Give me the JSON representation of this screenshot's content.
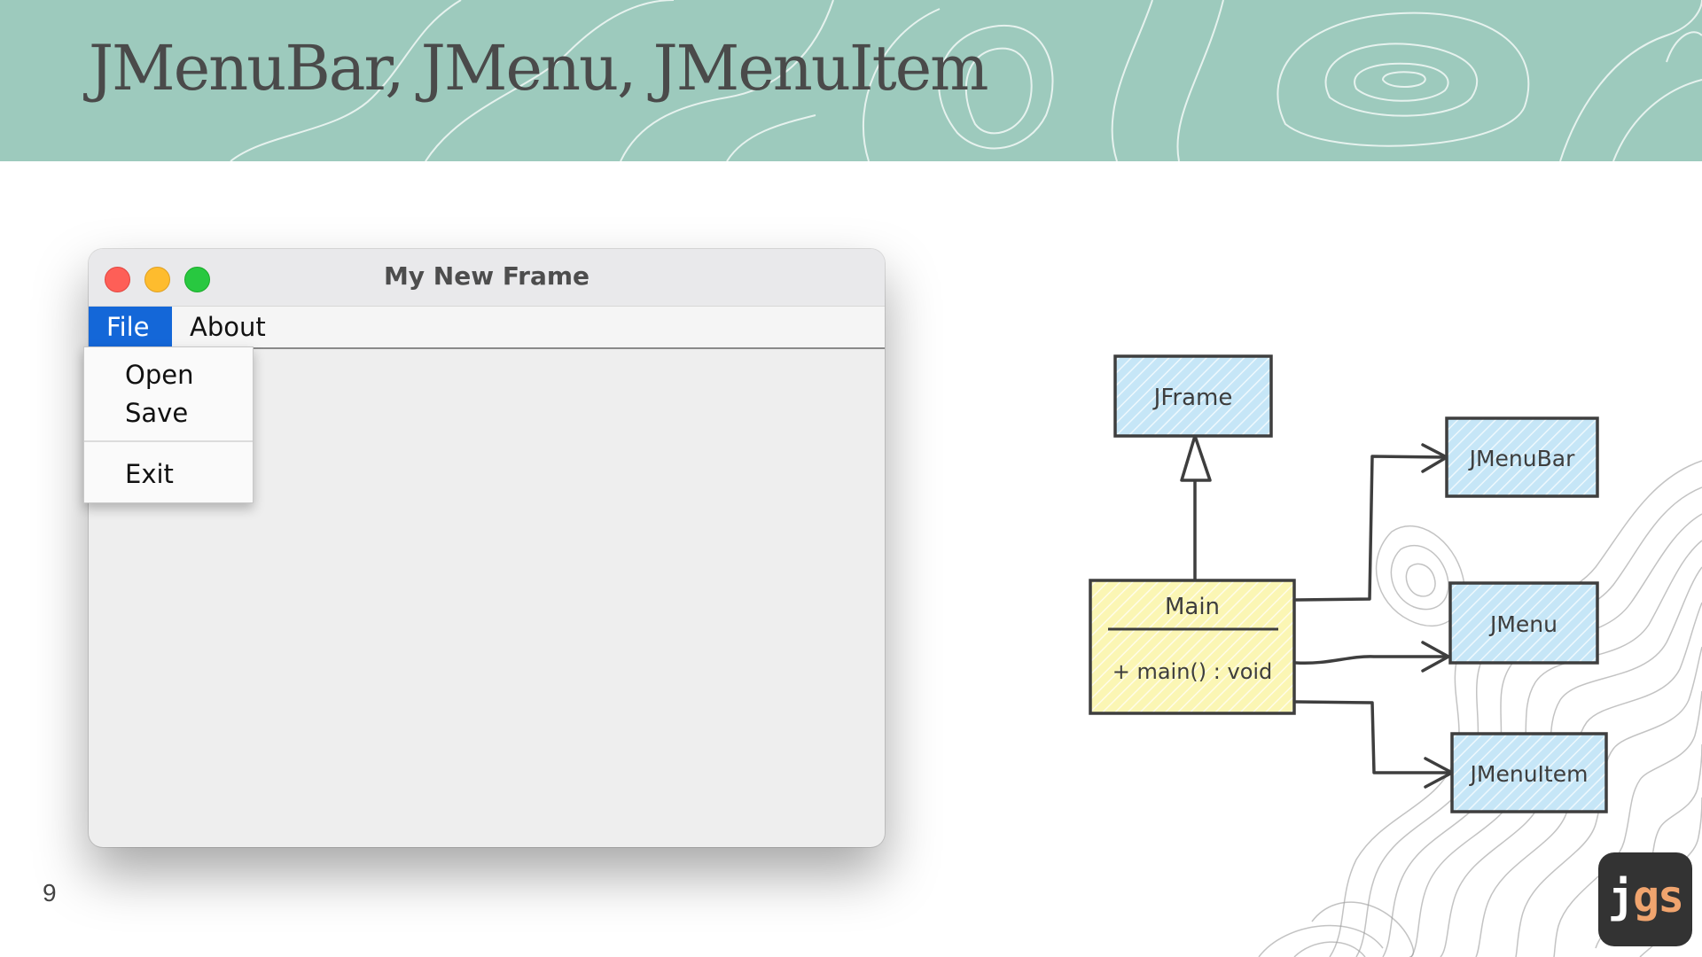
{
  "slide": {
    "title": "JMenuBar, JMenu, JMenuItem",
    "page_number": "9",
    "header_color": "#9dcabd"
  },
  "window": {
    "title": "My New Frame",
    "menus": [
      {
        "label": "File",
        "selected": true
      },
      {
        "label": "About",
        "selected": false
      }
    ],
    "dropdown_items": [
      "Open",
      "Save",
      "Exit"
    ]
  },
  "diagram": {
    "classes": [
      {
        "name": "JFrame",
        "fill": "#c6e6f7"
      },
      {
        "name": "JMenuBar",
        "fill": "#c6e6f7"
      },
      {
        "name": "JMenu",
        "fill": "#c6e6f7"
      },
      {
        "name": "JMenuItem",
        "fill": "#c6e6f7"
      },
      {
        "name": "Main",
        "operation": "+ main() : void",
        "fill": "#fbf6b4"
      }
    ],
    "relations": [
      {
        "from": "Main",
        "to": "JFrame",
        "type": "inheritance"
      },
      {
        "from": "Main",
        "to": "JMenuBar",
        "type": "association"
      },
      {
        "from": "Main",
        "to": "JMenu",
        "type": "association"
      },
      {
        "from": "Main",
        "to": "JMenuItem",
        "type": "association"
      }
    ]
  },
  "logo": {
    "part1": "j",
    "part2": "gs",
    "accent_color": "#f0a46e"
  },
  "icons": [
    "close-icon",
    "minimize-icon",
    "maximize-icon"
  ]
}
